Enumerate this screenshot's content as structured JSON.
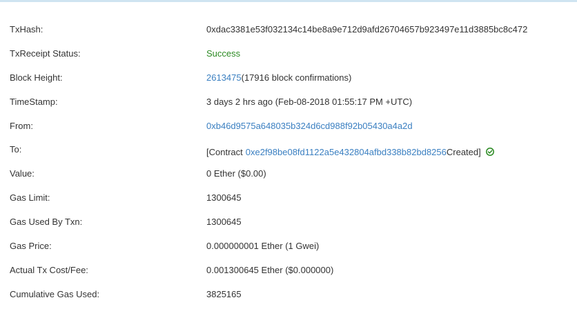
{
  "details": {
    "txhash": {
      "label": "TxHash:",
      "value": "0xdac3381e53f032134c14be8a9e712d9afd26704657b923497e11d3885bc8c472"
    },
    "status": {
      "label": "TxReceipt Status:",
      "value": "Success"
    },
    "block": {
      "label": "Block Height:",
      "number": "2613475",
      "confirmations": " (17916 block confirmations)"
    },
    "timestamp": {
      "label": "TimeStamp:",
      "value": "3 days 2 hrs ago (Feb-08-2018 01:55:17 PM +UTC)"
    },
    "from": {
      "label": "From:",
      "value": "0xb46d9575a648035b324d6cd988f92b05430a4a2d"
    },
    "to": {
      "label": "To:",
      "prefix": "[Contract ",
      "contract": "0xe2f98be08fd1122a5e432804afbd338b82bd8256",
      "suffix": " Created]",
      "icon": "check-circle-icon"
    },
    "value": {
      "label": "Value:",
      "value": "0 Ether ($0.00)"
    },
    "gas_limit": {
      "label": "Gas Limit:",
      "value": "1300645"
    },
    "gas_used": {
      "label": "Gas Used By Txn:",
      "value": "1300645"
    },
    "gas_price": {
      "label": "Gas Price:",
      "value": "0.000000001 Ether (1 Gwei)"
    },
    "tx_fee": {
      "label": "Actual Tx Cost/Fee:",
      "value": "0.001300645 Ether ($0.000000)"
    },
    "cumulative_gas": {
      "label": "Cumulative Gas Used:",
      "value": "3825165"
    }
  },
  "colors": {
    "link": "#3a7fc1",
    "success": "#2b8a22",
    "text": "#333333",
    "top_border": "#cfe4f1"
  }
}
